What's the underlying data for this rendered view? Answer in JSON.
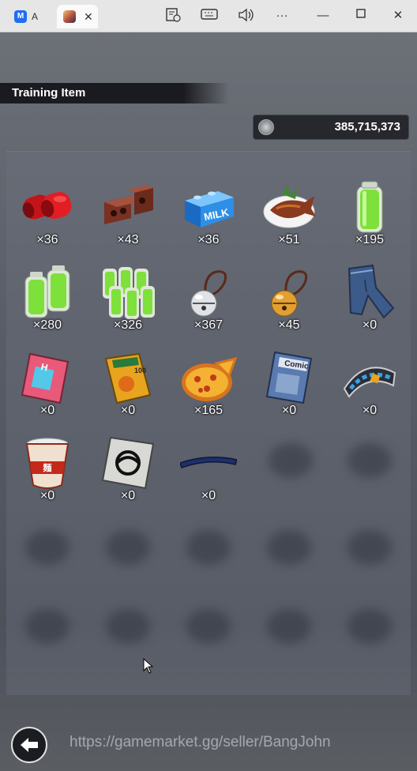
{
  "browser": {
    "tabs": [
      {
        "label": "A"
      },
      {
        "label": ""
      }
    ],
    "toolbar": [
      "reading-mode-icon",
      "keyboard-icon",
      "volume-icon",
      "more-icon",
      "minimize-icon",
      "maximize-icon",
      "close-icon"
    ]
  },
  "screen": {
    "title": "Training Item",
    "currency_value": "385,715,373",
    "items": [
      {
        "icon": "red-dumbbell-icon",
        "count": "×36"
      },
      {
        "icon": "brick-icon",
        "count": "×43"
      },
      {
        "icon": "milk-carton-icon",
        "count": "×36"
      },
      {
        "icon": "grilled-fish-icon",
        "count": "×51"
      },
      {
        "icon": "energy-drink-icon",
        "count": "×195"
      },
      {
        "icon": "energy-drink-pair-icon",
        "count": "×280"
      },
      {
        "icon": "energy-drink-pack-icon",
        "count": "×326"
      },
      {
        "icon": "silver-bell-icon",
        "count": "×367"
      },
      {
        "icon": "gold-bell-icon",
        "count": "×45"
      },
      {
        "icon": "jeans-icon",
        "count": "×0"
      },
      {
        "icon": "magazine-icon",
        "count": "×0"
      },
      {
        "icon": "book-icon",
        "count": "×0"
      },
      {
        "icon": "pizza-icon",
        "count": "×165"
      },
      {
        "icon": "comic-book-icon",
        "count": "×0"
      },
      {
        "icon": "headband-icon",
        "count": "×0"
      },
      {
        "icon": "cup-noodle-icon",
        "count": "×0"
      },
      {
        "icon": "emblem-card-icon",
        "count": "×0"
      },
      {
        "icon": "blue-band-icon",
        "count": "×0"
      }
    ],
    "watermark": "https://gamemarket.gg/seller/BangJohn",
    "colors": {
      "energy_green": "#7ee03a",
      "brick": "#8a3a2a",
      "milk_blue": "#2d8fe6"
    }
  }
}
